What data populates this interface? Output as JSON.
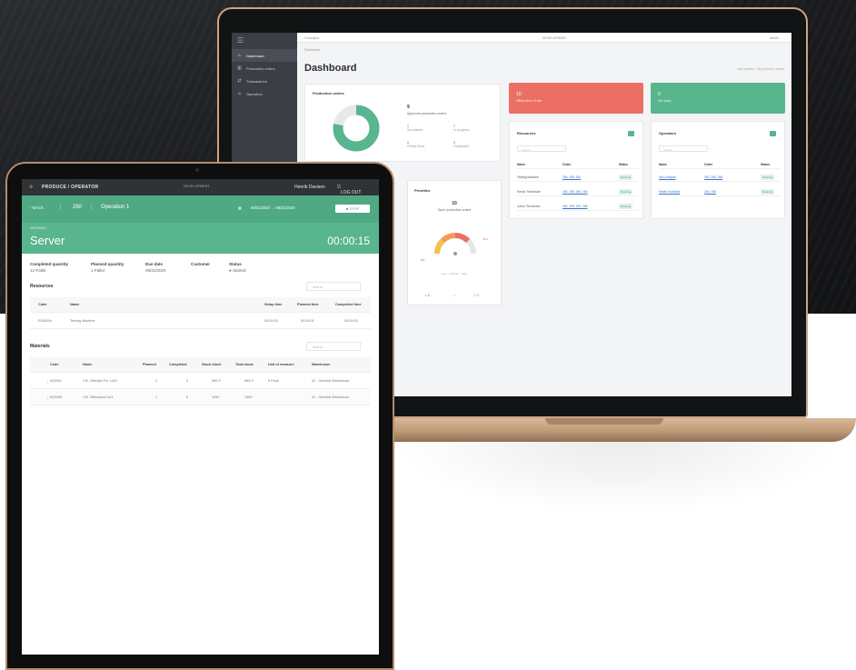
{
  "laptop": {
    "sidebar": {
      "items": [
        {
          "label": "Dashboard",
          "icon": "home-icon"
        },
        {
          "label": "Production orders",
          "icon": "factory-icon"
        },
        {
          "label": "Transactions",
          "icon": "transfer-icon"
        },
        {
          "label": "Operators",
          "icon": "users-icon"
        }
      ]
    },
    "topbar": {
      "left": "Conceptor",
      "center": "DEVELOPMENT",
      "right": "Henrik"
    },
    "breadcrumb": "Dashboard",
    "title": "Dashboard",
    "hint": "Last updated · All production orders",
    "production_orders": {
      "title": "Production orders",
      "count": "9",
      "count_label": "Approved production orders",
      "stats": [
        {
          "value": "1",
          "label": "Not started"
        },
        {
          "value": "7",
          "label": "In progress"
        },
        {
          "value": "0",
          "label": "Partial Done"
        },
        {
          "value": "0",
          "label": "Completed"
        }
      ],
      "donut_segments": [
        0.78,
        0.22
      ],
      "donut_colors": [
        "#58b58e",
        "#e6e8ea"
      ]
    },
    "kpis": [
      {
        "value": "10",
        "label": "Offline since 10 min",
        "color": "#ec6f66"
      },
      {
        "value": "0",
        "label": "Due today",
        "color": "#58b58e"
      }
    ],
    "priorities": {
      "title": "Priorities",
      "count": "10",
      "count_label": "Open production orders",
      "gauge_values": [
        0.15,
        0.35,
        0.5
      ],
      "gauge_labels": [
        "8%",
        "30%"
      ],
      "legend": "Low · Medium · High",
      "footer": [
        "0",
        "2",
        "8"
      ]
    },
    "resources": {
      "title": "Resources",
      "badge": "3",
      "search": "Search",
      "headers": [
        "Name",
        "Order",
        "Status"
      ],
      "rows": [
        {
          "name": "Testing Machine",
          "order": "250, 255, 261",
          "status": "Running"
        },
        {
          "name": "Senior Technician",
          "order": "250, 258, 260, 263",
          "status": "Running"
        },
        {
          "name": "Junior Technician",
          "order": "250, 255, 262, 266",
          "status": "Running"
        }
      ]
    },
    "operators": {
      "title": "Operators",
      "badge": "2",
      "search": "Search",
      "headers": [
        "Name",
        "Order",
        "Status"
      ],
      "rows": [
        {
          "name": "Ida Lindqvist",
          "order": "250, 255, 266",
          "status": "Running"
        },
        {
          "name": "Marek Kowalski",
          "order": "250, 258",
          "status": "Running"
        }
      ]
    }
  },
  "tablet": {
    "topbar": {
      "brand": "PRODUCE / OPERATOR",
      "env": "DEVELOPMENT",
      "user": "Henrik Davison",
      "logout": "LOG OUT"
    },
    "header": {
      "back": "BACK",
      "order_no": "260",
      "operation": "Operation 1",
      "dates": "08/31/2020 → 08/31/2020",
      "stop_label": "STOP",
      "item_code": "W3700001",
      "item_name": "Server",
      "timer": "00:00:15"
    },
    "info": [
      {
        "label": "Completed quantity",
        "value": "12 Pallet"
      },
      {
        "label": "Planned quantity",
        "value": "1 Pallet"
      },
      {
        "label": "Due date",
        "value": "08/31/2020"
      },
      {
        "label": "Customer",
        "value": ""
      },
      {
        "label": "Status",
        "value": "Started"
      }
    ],
    "resources": {
      "title": "Resources",
      "search": "Search",
      "headers": [
        "Code",
        "Name",
        "Setup time",
        "Planned time",
        "Completed time"
      ],
      "rows": [
        {
          "code": "R30000x",
          "name": "Testing Machine",
          "setup": "00:00:00",
          "planned": "00:00:01",
          "completed": "00:00:00"
        }
      ]
    },
    "materials": {
      "title": "Materials",
      "search": "Search",
      "headers": [
        "Code",
        "Name",
        "Planned",
        "Completed",
        "Stock stock",
        "Total stock",
        "Unit of measure",
        "Warehouse"
      ],
      "rows": [
        {
          "code": "A00001",
          "name": "J.B. Officejet Pro 1420",
          "planned": "1",
          "completed": "0",
          "stock": "585 S",
          "total": "585 S",
          "uom": "6 Pack",
          "warehouse": "01 - General Warehouse"
        },
        {
          "code": "A00006",
          "name": "J.B. Officeprint 1111",
          "planned": "1",
          "completed": "0",
          "stock": "1050",
          "total": "1050",
          "uom": "",
          "warehouse": "01 - General Warehouse"
        }
      ]
    }
  }
}
